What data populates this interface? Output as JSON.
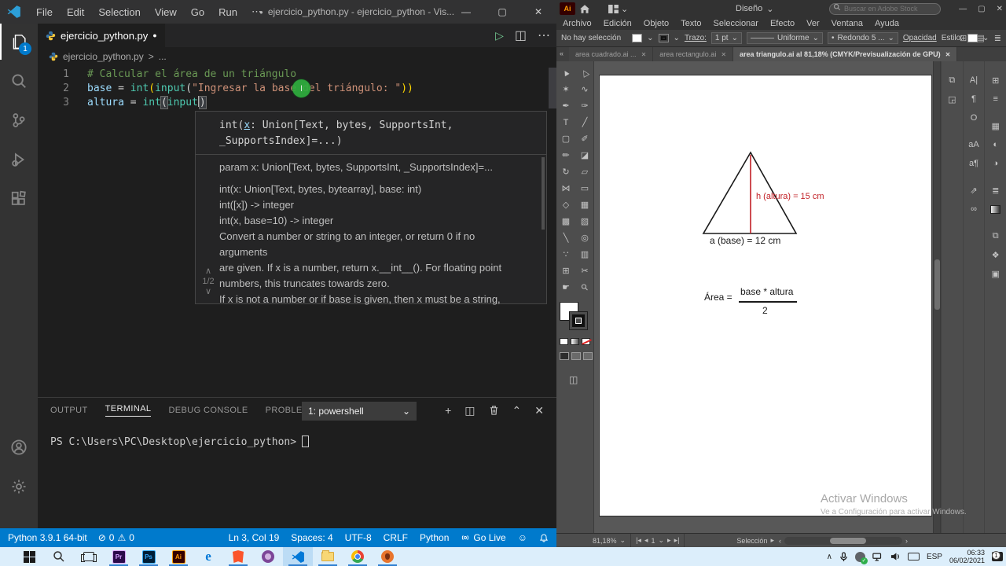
{
  "glyphs": {
    "dot": "●",
    "close": "✕",
    "min": "—",
    "max": "▢",
    "more": "⋯",
    "play": "▷",
    "split": "◫",
    "plus": "+",
    "gt": ">",
    "ellipsis": "...",
    "chevron_down": "⌄",
    "chevron_up": "⌃",
    "up": "∧",
    "down": "∨",
    "error": "⊘",
    "warn": "⚠",
    "smiley": "☺",
    "collapse": "«",
    "first": "|◂",
    "prev": "◂",
    "next": "▸",
    "last": "▸|",
    "left": "‹",
    "right": "›",
    "bullet": "•",
    "stroke_line": "———",
    "grid": "⊞",
    "bars": "▤",
    "lines": "≣",
    "tray_chevron": "∧",
    "line_sel": "▸"
  },
  "vscode": {
    "titlebar": {
      "menus": [
        "File",
        "Edit",
        "Selection",
        "View",
        "Go",
        "Run",
        "⋯"
      ],
      "title_prefix": "●",
      "title": "ejercicio_python.py - ejercicio_python - Vis..."
    },
    "activitybar": {
      "explorer_badge": "1"
    },
    "tab": {
      "label": "ejercicio_python.py"
    },
    "breadcrumb": {
      "file": "ejercicio_python.py",
      "sep": ">",
      "more": "..."
    },
    "editor": {
      "line_numbers": [
        "1",
        "2",
        "3"
      ],
      "code": {
        "l1_comment": "# Calcular el área de un triángulo",
        "l2_var": "base",
        "l2_eq": " = ",
        "l2_int": "int",
        "l2_p1": "(",
        "l2_input": "input",
        "l2_p2": "(",
        "l2_str": "\"Ingresar la base del triángulo: \"",
        "l2_p3": "))",
        "l3_var": "altura",
        "l3_eq": " = ",
        "l3_int": "int",
        "l3_p1": "(",
        "l3_input": "input",
        "l3_p2": ")"
      }
    },
    "hover": {
      "sig_fn": "int",
      "sig_open": "(",
      "sig_param": "x",
      "sig_rest1": ": Union[Text, bytes, SupportsInt,",
      "sig_rest2": "_SupportsIndex]=...)",
      "body": [
        "param x: Union[Text, bytes, SupportsInt, _SupportsIndex]=...",
        "int(x: Union[Text, bytes, bytearray], base: int)",
        "int([x]) -> integer",
        "int(x, base=10) -> integer",
        "Convert a number or string to an integer, or return 0 if no",
        "arguments",
        "are given.  If x is a number, return x.__int__().  For floating point",
        "numbers, this truncates towards zero.",
        "If x is not a number or if base is given, then x must be a string,"
      ],
      "pager": "1/2"
    },
    "panel": {
      "tabs": [
        "OUTPUT",
        "TERMINAL",
        "DEBUG CONSOLE",
        "PROBLEMS"
      ],
      "shell_select": "1: powershell",
      "prompt": "PS C:\\Users\\PC\\Desktop\\ejercicio_python>"
    },
    "statusbar": {
      "python_version": "Python 3.9.1 64-bit",
      "errors": "0",
      "warnings": "0",
      "cursor": "Ln 3, Col 19",
      "spaces": "Spaces: 4",
      "encoding": "UTF-8",
      "eol": "CRLF",
      "language": "Python",
      "golive": "Go Live"
    }
  },
  "illustrator": {
    "workspace": "Diseño",
    "search_placeholder": "Buscar en Adobe Stock",
    "menus": [
      "Archivo",
      "Edición",
      "Objeto",
      "Texto",
      "Seleccionar",
      "Efecto",
      "Ver",
      "Ventana",
      "Ayuda"
    ],
    "options": {
      "selection": "No hay selección",
      "stroke_label": "Trazo:",
      "stroke_value": "1 pt",
      "variable_width": "Uniforme",
      "brush_def": "Redondo 5 ...",
      "opacity_label": "Opacidad",
      "style_label": "Estilo:"
    },
    "doc_tabs": [
      {
        "label": "area cuadrado.ai ..."
      },
      {
        "label": "area rectangulo.ai"
      },
      {
        "label": "area triangulo.ai al 81,18% (CMYK/Previsualización de GPU)"
      }
    ],
    "tools": [
      {
        "n": "selection-tool",
        "g": "▲"
      },
      {
        "n": "direct-selection-tool",
        "g": "△"
      },
      {
        "n": "magic-wand-tool",
        "g": "✶"
      },
      {
        "n": "lasso-tool",
        "g": "∿"
      },
      {
        "n": "pen-tool",
        "g": "✒"
      },
      {
        "n": "curvature-tool",
        "g": "✑"
      },
      {
        "n": "type-tool",
        "g": "T"
      },
      {
        "n": "line-segment-tool",
        "g": "╱"
      },
      {
        "n": "rectangle-tool",
        "g": "▢"
      },
      {
        "n": "paintbrush-tool",
        "g": "✐"
      },
      {
        "n": "shaper-tool",
        "g": "✏"
      },
      {
        "n": "eraser-tool",
        "g": "◪"
      },
      {
        "n": "rotate-tool",
        "g": "↻"
      },
      {
        "n": "scale-tool",
        "g": "▱"
      },
      {
        "n": "width-tool",
        "g": "⋈"
      },
      {
        "n": "free-transform-tool",
        "g": "▭"
      },
      {
        "n": "shape-builder-tool",
        "g": "◇"
      },
      {
        "n": "perspective-grid-tool",
        "g": "▦"
      },
      {
        "n": "mesh-tool",
        "g": "▩"
      },
      {
        "n": "gradient-tool",
        "g": "▧"
      },
      {
        "n": "eyedropper-tool",
        "g": "╲"
      },
      {
        "n": "blend-tool",
        "g": "◎"
      },
      {
        "n": "symbol-sprayer-tool",
        "g": "∵"
      },
      {
        "n": "column-graph-tool",
        "g": "▥"
      },
      {
        "n": "artboard-tool",
        "g": "⊞"
      },
      {
        "n": "slice-tool",
        "g": "✂"
      },
      {
        "n": "hand-tool",
        "g": "☛"
      },
      {
        "n": "zoom-tool",
        "g": "⚲"
      }
    ],
    "dock1": [
      {
        "g": "⧉"
      },
      {
        "g": "◲"
      }
    ],
    "dock2": [
      {
        "g": "A|"
      },
      {
        "g": "¶"
      },
      {
        "g": "O"
      },
      {
        "g": "aA"
      },
      {
        "g": "a¶"
      },
      {
        "g": "⇗"
      },
      {
        "g": "∞"
      }
    ],
    "dock3": [
      {
        "g": "⊞"
      },
      {
        "g": "≡"
      },
      {
        "g": "▦"
      },
      {
        "g": "◐"
      },
      {
        "g": "◑"
      },
      {
        "g": "≣"
      },
      {
        "g": "▧"
      },
      {
        "g": "⧉"
      },
      {
        "g": "❖"
      },
      {
        "g": "▣"
      }
    ],
    "artboard": {
      "h_label": "h (altura) = 15 cm",
      "base_label": "a (base) = 12 cm",
      "formula_lhs": "Área =",
      "formula_num": "base * altura",
      "formula_den": "2"
    },
    "watermark": {
      "line1": "Activar Windows",
      "line2": "Ve a Configuración para activar Windows."
    },
    "statusbar": {
      "zoom": "81,18%",
      "artboard_num": "1",
      "tool": "Selección"
    }
  },
  "taskbar": {
    "letters": {
      "pr": "Pr",
      "ps": "Ps",
      "ai": "Ai",
      "edge": "e"
    },
    "tray": {
      "lang": "ESP",
      "time": "06:33",
      "date": "06/02/2021",
      "notif_badge": "1"
    }
  },
  "colors": {
    "statusbar_blue": "#007acc",
    "triangle_red": "#c22026",
    "comment_green": "#6a9955",
    "string_orange": "#ce9178"
  }
}
